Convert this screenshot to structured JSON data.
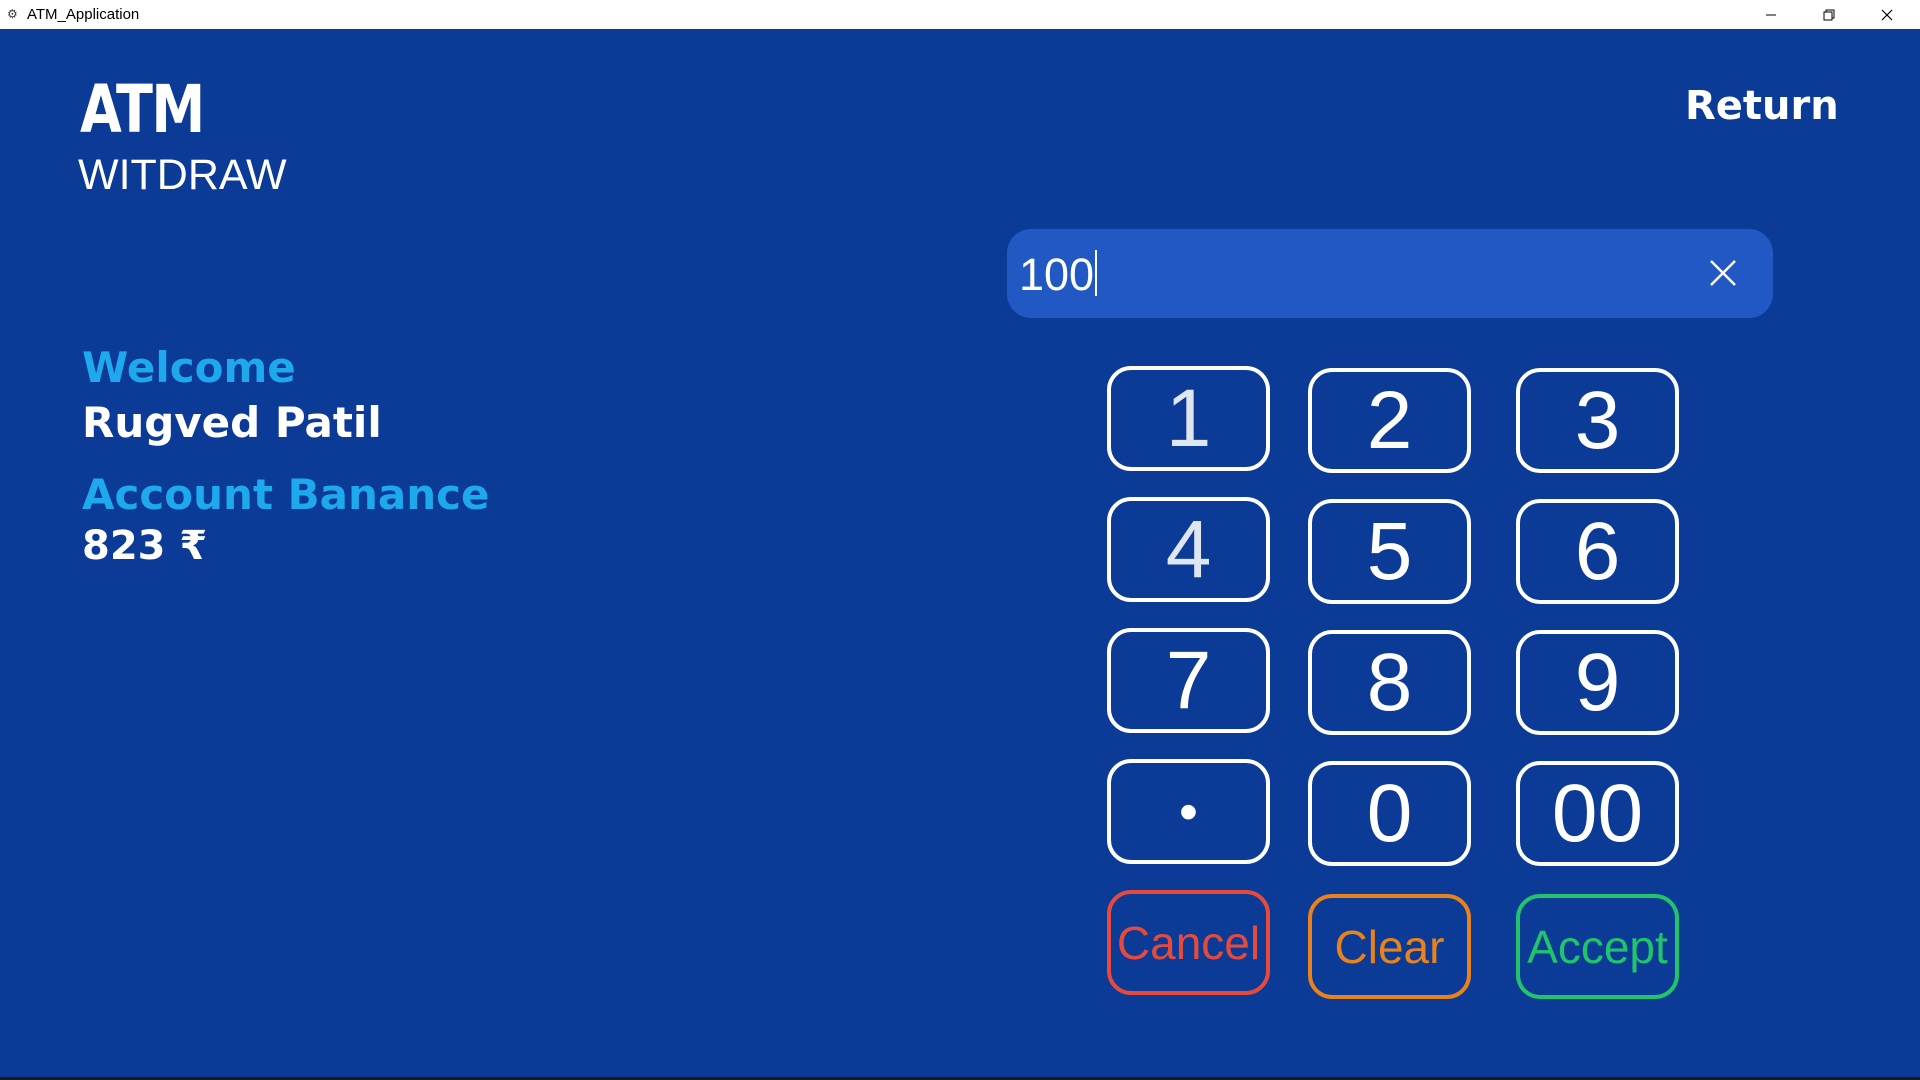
{
  "window": {
    "title": "ATM_Application",
    "icon": "app-icon"
  },
  "header": {
    "brand": "ATM",
    "page_title": "WITDRAW",
    "return_label": "Return"
  },
  "account": {
    "welcome_label": "Welcome",
    "user_name": "Rugved Patil",
    "balance_label": "Account Banance",
    "balance_value": "823 ₹"
  },
  "amount_input": {
    "value": "100",
    "clear_icon": "close-icon"
  },
  "keypad": {
    "keys": [
      "1",
      "2",
      "3",
      "4",
      "5",
      "6",
      "7",
      "8",
      "9",
      "•",
      "0",
      "00"
    ],
    "cancel_label": "Cancel",
    "clear_label": "Clear",
    "accept_label": "Accept"
  },
  "colors": {
    "background": "#0c3a97",
    "input_background": "#2258c4",
    "accent_label": "#1ea9ee",
    "cancel": "#e64a3c",
    "clear": "#e8821c",
    "accept": "#1fc46b"
  }
}
